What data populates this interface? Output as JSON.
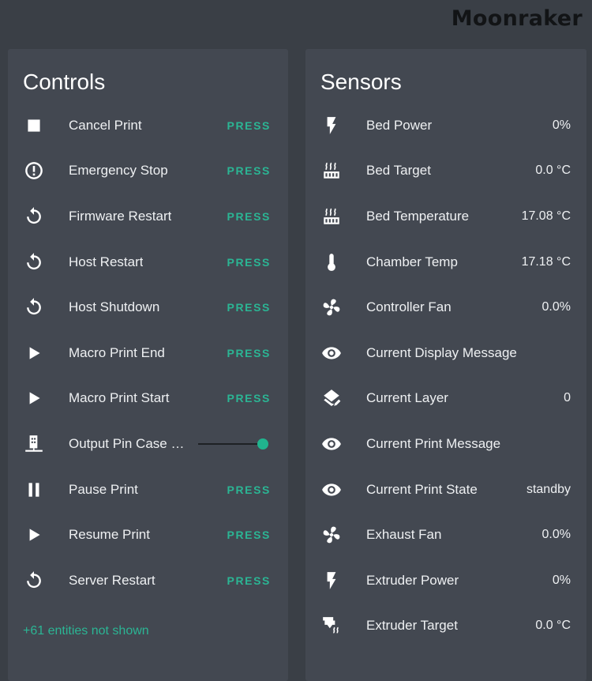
{
  "header": {
    "logo_text": "Moonraker"
  },
  "controls": {
    "title": "Controls",
    "items": [
      {
        "icon": "stop-icon",
        "label": "Cancel Print",
        "action": "PRESS"
      },
      {
        "icon": "alert-circle-icon",
        "label": "Emergency Stop",
        "action": "PRESS"
      },
      {
        "icon": "restart-icon",
        "label": "Firmware Restart",
        "action": "PRESS"
      },
      {
        "icon": "restart-icon",
        "label": "Host Restart",
        "action": "PRESS"
      },
      {
        "icon": "restart-icon",
        "label": "Host Shutdown",
        "action": "PRESS"
      },
      {
        "icon": "play-icon",
        "label": "Macro Print End",
        "action": "PRESS"
      },
      {
        "icon": "play-icon",
        "label": "Macro Print Start",
        "action": "PRESS"
      },
      {
        "icon": "electric-switch-icon",
        "label": "Output Pin Case Light",
        "slider_value": 1.0
      },
      {
        "icon": "pause-icon",
        "label": "Pause Print",
        "action": "PRESS"
      },
      {
        "icon": "play-icon",
        "label": "Resume Print",
        "action": "PRESS"
      },
      {
        "icon": "restart-icon",
        "label": "Server Restart",
        "action": "PRESS"
      }
    ],
    "more_link": "+61 entities not shown"
  },
  "sensors": {
    "title": "Sensors",
    "items": [
      {
        "icon": "flash-icon",
        "label": "Bed Power",
        "value": "0%"
      },
      {
        "icon": "radiator-icon",
        "label": "Bed Target",
        "value": "0.0 °C"
      },
      {
        "icon": "radiator-icon",
        "label": "Bed Temperature",
        "value": "17.08 °C"
      },
      {
        "icon": "thermometer-icon",
        "label": "Chamber Temp",
        "value": "17.18 °C"
      },
      {
        "icon": "fan-icon",
        "label": "Controller Fan",
        "value": "0.0%"
      },
      {
        "icon": "eye-icon",
        "label": "Current Display Message",
        "value": ""
      },
      {
        "icon": "layers-edit-icon",
        "label": "Current Layer",
        "value": "0"
      },
      {
        "icon": "eye-icon",
        "label": "Current Print Message",
        "value": ""
      },
      {
        "icon": "eye-icon",
        "label": "Current Print State",
        "value": "standby"
      },
      {
        "icon": "fan-icon",
        "label": "Exhaust Fan",
        "value": "0.0%"
      },
      {
        "icon": "flash-icon",
        "label": "Extruder Power",
        "value": "0%"
      },
      {
        "icon": "printer-nozzle-heat-icon",
        "label": "Extruder Target",
        "value": "0.0 °C"
      }
    ]
  },
  "colors": {
    "background": "#3a3f46",
    "card": "#434851",
    "accent": "#2bb594",
    "logo": "#121416"
  }
}
